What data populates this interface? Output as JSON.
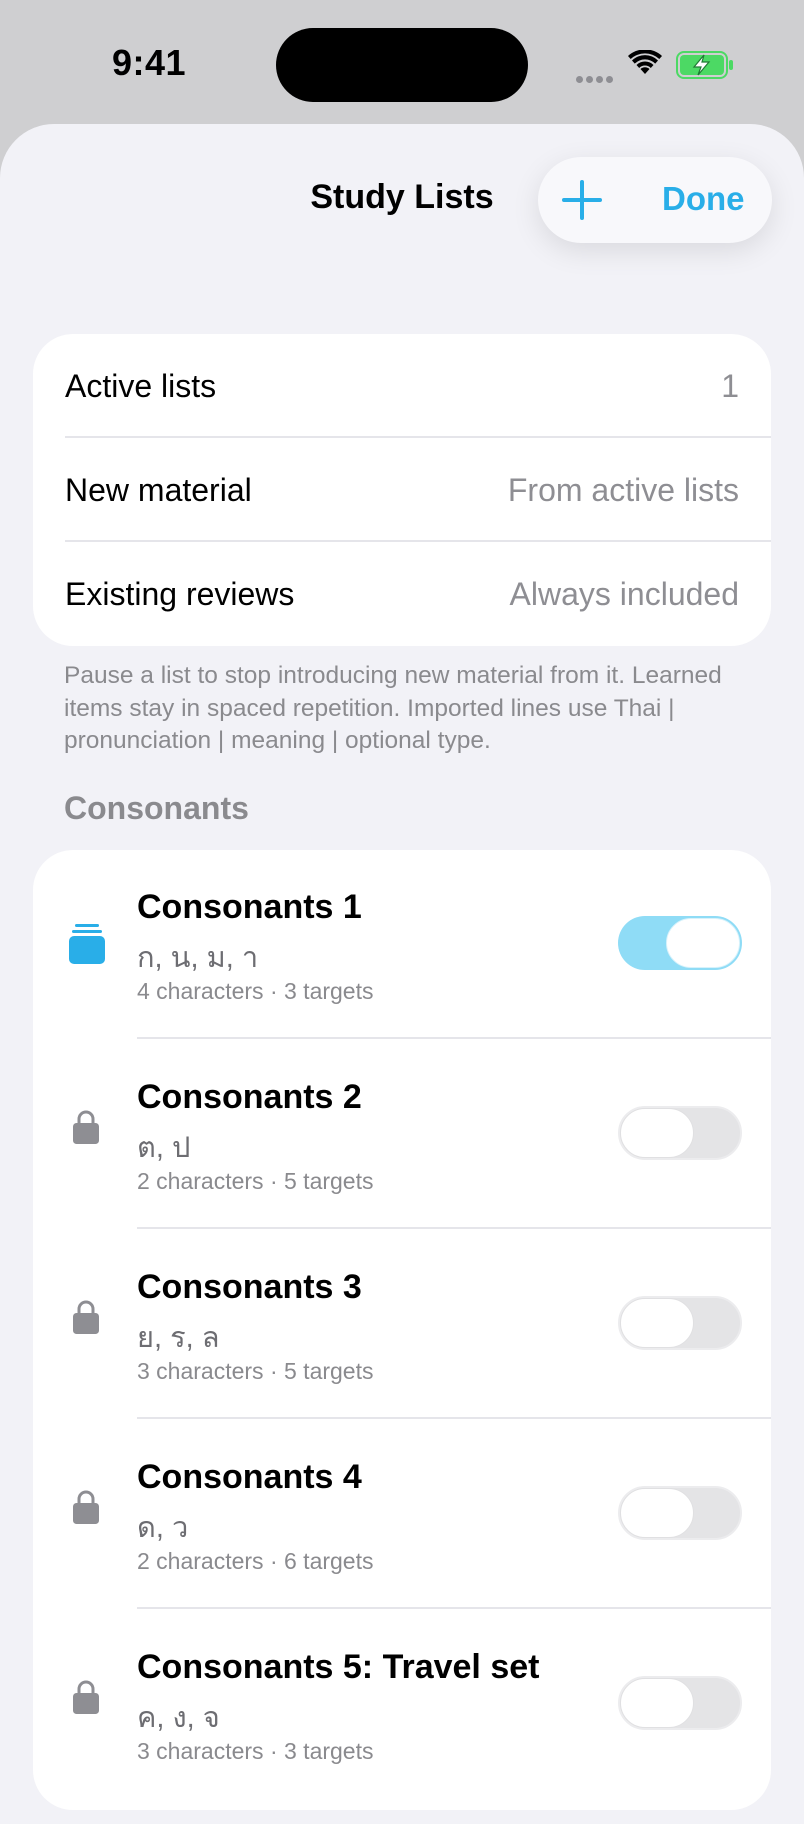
{
  "status_bar": {
    "time": "9:41",
    "icons": [
      "signal-icon",
      "wifi-icon",
      "battery-charging-icon"
    ]
  },
  "nav": {
    "title": "Study Lists",
    "add_icon": "plus-icon",
    "done_label": "Done"
  },
  "summary": {
    "rows": [
      {
        "label": "Active lists",
        "value": "1"
      },
      {
        "label": "New material",
        "value": "From active lists"
      },
      {
        "label": "Existing reviews",
        "value": "Always included"
      }
    ],
    "footnote": "Pause a list to stop introducing new material from it. Learned items stay in spaced repetition. Imported lines use Thai | pronunciation | meaning | optional type."
  },
  "section": {
    "header": "Consonants",
    "lists": [
      {
        "title": "Consonants 1",
        "chars": "ก, น, ม, า",
        "meta": "4 characters · 3 targets",
        "icon": "stack-icon",
        "active": true
      },
      {
        "title": "Consonants 2",
        "chars": "ต, ป",
        "meta": "2 characters · 5 targets",
        "icon": "lock-icon",
        "active": false
      },
      {
        "title": "Consonants 3",
        "chars": "ย, ร, ล",
        "meta": "3 characters · 5 targets",
        "icon": "lock-icon",
        "active": false
      },
      {
        "title": "Consonants 4",
        "chars": "ด, ว",
        "meta": "2 characters · 6 targets",
        "icon": "lock-icon",
        "active": false
      },
      {
        "title": "Consonants 5: Travel set",
        "chars": "ค, ง, จ",
        "meta": "3 characters · 3 targets",
        "icon": "lock-icon",
        "active": false
      }
    ]
  },
  "colors": {
    "accent": "#29aee8",
    "toggle_on": "#8fdcf6",
    "background": "#f2f2f7",
    "secondary_text": "#8a8a8e"
  }
}
